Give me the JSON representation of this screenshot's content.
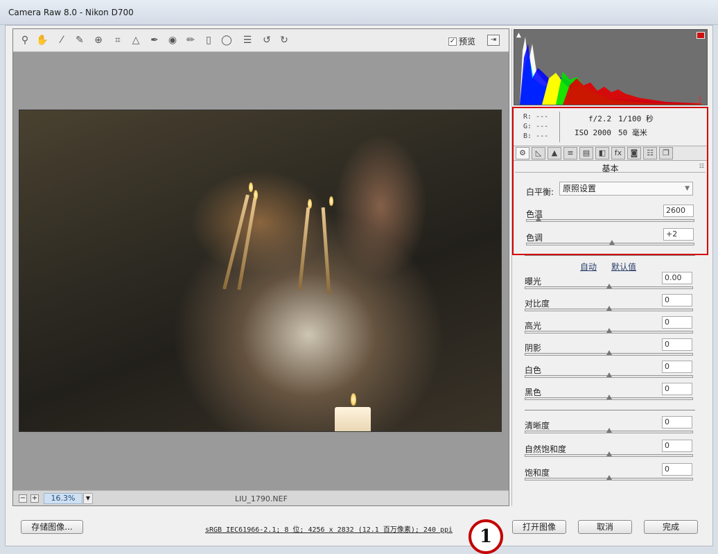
{
  "window": {
    "title": "Camera Raw 8.0 -  Nikon D700"
  },
  "toolbar": {
    "tools": [
      {
        "name": "zoom-tool-icon",
        "glyph": "⚲"
      },
      {
        "name": "hand-tool-icon",
        "glyph": "✋"
      },
      {
        "name": "white-balance-tool-icon",
        "glyph": "⁄"
      },
      {
        "name": "color-sampler-tool-icon",
        "glyph": "✎"
      },
      {
        "name": "target-adjust-tool-icon",
        "glyph": "⊕"
      },
      {
        "name": "crop-tool-icon",
        "glyph": "⌗"
      },
      {
        "name": "straighten-tool-icon",
        "glyph": "△"
      },
      {
        "name": "spot-removal-tool-icon",
        "glyph": "✒"
      },
      {
        "name": "red-eye-tool-icon",
        "glyph": "◉"
      },
      {
        "name": "adjustment-brush-icon",
        "glyph": "✏"
      },
      {
        "name": "graduated-filter-icon",
        "glyph": "▯"
      },
      {
        "name": "radial-filter-icon",
        "glyph": "◯"
      },
      {
        "name": "preferences-icon",
        "glyph": "☰"
      },
      {
        "name": "rotate-left-icon",
        "glyph": "↺"
      },
      {
        "name": "rotate-right-icon",
        "glyph": "↻"
      }
    ],
    "preview_label": "预览",
    "preview_checked": "✓"
  },
  "viewer": {
    "zoom_minus": "−",
    "zoom_plus": "+",
    "zoom_value": "16.3%",
    "zoom_drop": "▼",
    "filename": "LIU_1790.NEF"
  },
  "info": {
    "r": "R:  ---",
    "g": "G:  ---",
    "b": "B:  ---",
    "aperture": "f/2.2",
    "shutter": "1/100 秒",
    "iso": "ISO 2000",
    "focal": "50 毫米"
  },
  "panel_tabs": [
    "⚙",
    "◺",
    "▲",
    "≡",
    "▤",
    "◧",
    "fx",
    "◙",
    "☷",
    "❐"
  ],
  "basic": {
    "title": "基本",
    "menu": "☷",
    "wb_label": "白平衡:",
    "wb_value": "原照设置",
    "temp_label": "色温",
    "temp_value": "2600",
    "tint_label": "色调",
    "tint_value": "+2",
    "auto_label": "自动",
    "default_label": "默认值",
    "params": [
      {
        "label": "曝光",
        "value": "0.00"
      },
      {
        "label": "对比度",
        "value": "0"
      },
      {
        "label": "高光",
        "value": "0"
      },
      {
        "label": "阴影",
        "value": "0"
      },
      {
        "label": "白色",
        "value": "0"
      },
      {
        "label": "黑色",
        "value": "0"
      }
    ],
    "presence": [
      {
        "label": "清晰度",
        "value": "0"
      },
      {
        "label": "自然饱和度",
        "value": "0"
      },
      {
        "label": "饱和度",
        "value": "0"
      }
    ]
  },
  "bottom": {
    "save_label": "存储图像...",
    "workflow": "sRGB IEC61966-2.1; 8 位; 4256 x 2832 (12.1 百万像素); 240 ppi",
    "badge": "1",
    "open_label": "打开图像",
    "cancel_label": "取消",
    "done_label": "完成"
  },
  "colors": {
    "highlight_box": "#d40000",
    "zoom_field": "#cfe0f2"
  }
}
